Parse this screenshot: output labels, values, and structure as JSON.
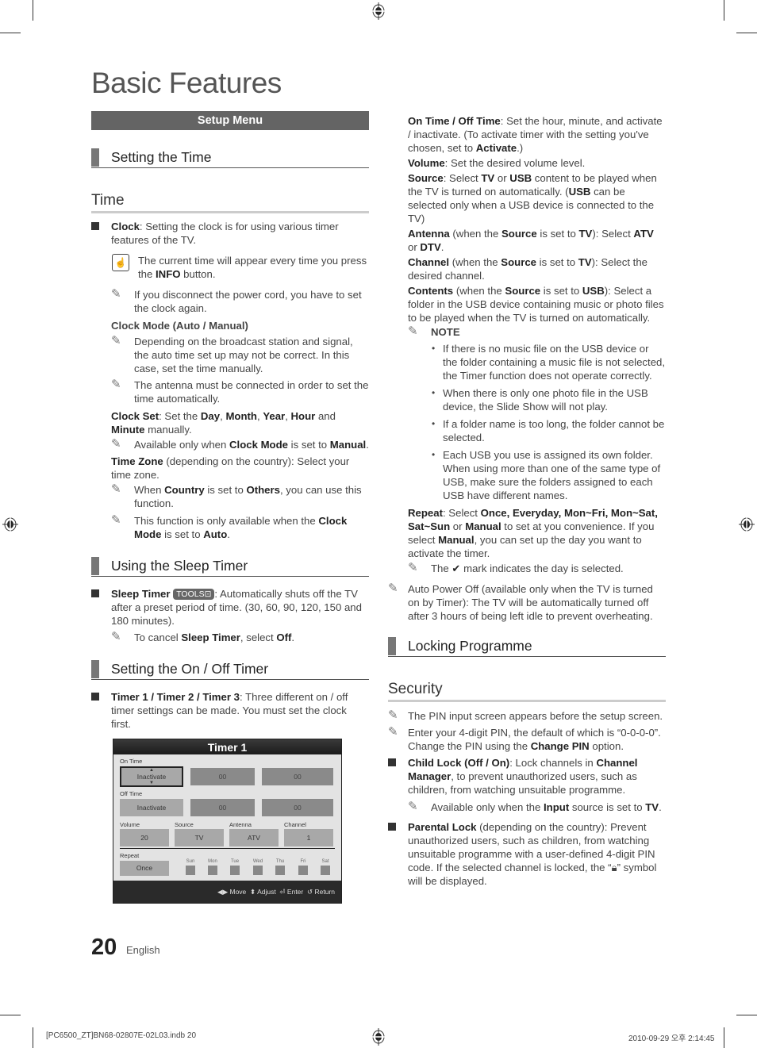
{
  "page": {
    "title": "Basic Features",
    "page_number": "20",
    "language": "English",
    "slug_left": "[PC6500_ZT]BN68-02807E-02L03.indb   20",
    "slug_right": "2010-09-29   오후 2:14:45"
  },
  "left": {
    "setup_bar": "Setup Menu",
    "sec_time": "Setting the Time",
    "sub_time": "Time",
    "clock_bold": "Clock",
    "clock_text": ": Setting the clock is for using various timer features of the TV.",
    "info_note_a": "The current time will appear every time you press the ",
    "info_note_b": "INFO",
    "info_note_c": " button.",
    "memo_power": "If you disconnect the power cord, you have to set the clock again.",
    "clock_mode_head": "Clock Mode (Auto / Manual)",
    "memo_broadcast": "Depending on the broadcast station and signal, the auto time set up may not be correct. In this case, set the time manually.",
    "memo_antenna": "The antenna must be connected in order to set the time automatically.",
    "clockset_b1": "Clock Set",
    "clockset_t1": ": Set the ",
    "clockset_b2": "Day",
    "clockset_b3": "Month",
    "clockset_b4": "Year",
    "clockset_b5": "Hour",
    "clockset_t2": " and ",
    "clockset_b6": "Minute",
    "clockset_t3": " manually.",
    "memo_avail_a": "Available only when ",
    "memo_avail_b": "Clock Mode",
    "memo_avail_c": " is set to ",
    "memo_avail_d": "Manual",
    "tz_b": "Time Zone",
    "tz_t": " (depending on the country): Select your time zone.",
    "memo_country_a": "When ",
    "memo_country_b": "Country",
    "memo_country_c": " is set to ",
    "memo_country_d": "Others",
    "memo_country_e": ", you can use this function.",
    "memo_func_a": "This function is only available when the ",
    "memo_func_b": "Clock Mode",
    "memo_func_c": " is set to ",
    "memo_func_d": "Auto",
    "sec_sleep": "Using the Sleep Timer",
    "sleep_b": "Sleep Timer",
    "tools_label": "TOOLS⊡",
    "sleep_t": ": Automatically shuts off the TV after a preset period of time. (30, 60, 90, 120, 150 and 180 minutes).",
    "memo_cancel_a": "To cancel ",
    "memo_cancel_b": "Sleep Timer",
    "memo_cancel_c": ", select ",
    "memo_cancel_d": "Off",
    "sec_onoff": "Setting the On / Off Timer",
    "timers_b": "Timer 1 / Timer 2 / Timer 3",
    "timers_t": ": Three different on / off timer settings can be made. You must set the clock first."
  },
  "timer_panel": {
    "title": "Timer 1",
    "on_time_label": "On Time",
    "on_state": "Inactivate",
    "on_hour": "00",
    "on_min": "00",
    "off_time_label": "Off Time",
    "off_state": "Inactivate",
    "off_hour": "00",
    "off_min": "00",
    "volume_label": "Volume",
    "volume_value": "20",
    "source_label": "Source",
    "source_value": "TV",
    "antenna_label": "Antenna",
    "antenna_value": "ATV",
    "channel_label": "Channel",
    "channel_value": "1",
    "repeat_label": "Repeat",
    "repeat_value": "Once",
    "days": [
      "Sun",
      "Mon",
      "Tue",
      "Wed",
      "Thu",
      "Fri",
      "Sat"
    ],
    "footer": {
      "move": "Move",
      "adjust": "Adjust",
      "enter": "Enter",
      "return": "Return"
    }
  },
  "right": {
    "onoff_b": "On Time / Off Time",
    "onoff_t": ": Set the hour, minute, and activate / inactivate. (To activate timer with the setting you've chosen, set to ",
    "onoff_b2": "Activate",
    "onoff_t2": ".)",
    "vol_b": "Volume",
    "vol_t": ": Set the desired volume level.",
    "src_b": "Source",
    "src_t1": ": Select ",
    "src_b2": "TV",
    "src_t2": " or ",
    "src_b3": "USB",
    "src_t3": " content to be played when the TV is turned on automatically. (",
    "src_b4": "USB",
    "src_t4": " can be selected only when a USB device is connected to the TV)",
    "ant_b": "Antenna",
    "ant_t1": " (when the ",
    "ant_b2": "Source",
    "ant_t2": " is set to ",
    "ant_b3": "TV",
    "ant_t3": "): Select ",
    "ant_b4": "ATV",
    "ant_t4": " or ",
    "ant_b5": "DTV",
    "ant_t5": ".",
    "ch_b": "Channel",
    "ch_t1": " (when the ",
    "ch_b2": "Source",
    "ch_t2": " is set to ",
    "ch_b3": "TV",
    "ch_t3": "): Select the desired channel.",
    "ct_b": "Contents",
    "ct_t1": " (when the ",
    "ct_b2": "Source",
    "ct_t2": " is set to ",
    "ct_b3": "USB",
    "ct_t3": "): Select a folder in the USB device containing music or photo files to be played when the TV is turned on automatically.",
    "note_label": "NOTE",
    "notes": [
      "If there is no music file on the USB device or the folder containing a music file is not selected, the Timer function does not operate correctly.",
      "When there is only one photo file in the USB device, the Slide Show will not play.",
      "If a folder name is too long, the folder cannot be selected.",
      "Each USB you use is assigned its own folder. When using more than one of the same type of USB, make sure the folders assigned to each USB have different names."
    ],
    "rep_b": "Repeat",
    "rep_t1": ": Select ",
    "rep_b2": "Once, Everyday, Mon~Fri, Mon~Sat, Sat~Sun",
    "rep_t2": " or ",
    "rep_b3": "Manual",
    "rep_t3": " to set at you convenience. If you select ",
    "rep_b4": "Manual",
    "rep_t4": ", you can set up the day you want to activate the timer.",
    "memo_check_a": "The ",
    "memo_check_b": " mark indicates the day is selected.",
    "memo_autooff": "Auto Power Off (available only when the TV is turned on by Timer): The TV will be automatically turned off after 3 hours of being left idle to prevent overheating.",
    "sec_lock": "Locking Programme",
    "sub_security": "Security",
    "memo_pin": "The PIN input screen appears before the setup screen.",
    "memo_default_a": "Enter your 4-digit PIN, the default of which is “0-0-0-0”. Change the PIN using the ",
    "memo_default_b": "Change PIN",
    "memo_default_c": " option.",
    "child_b": "Child Lock (Off / On)",
    "child_t1": ": Lock channels in ",
    "child_b2": "Channel Manager",
    "child_t2": ", to prevent unauthorized users, such as children, from watching unsuitable programme.",
    "memo_input_a": "Available only when the ",
    "memo_input_b": "Input",
    "memo_input_c": " source is set to ",
    "memo_input_d": "TV",
    "parental_b": "Parental Lock",
    "parental_t1": " (depending on the country): Prevent unauthorized users, such as children, from watching unsuitable programme with a user-defined 4-digit PIN code. If the selected channel is locked, the “",
    "parental_t2": "” symbol will be displayed."
  }
}
